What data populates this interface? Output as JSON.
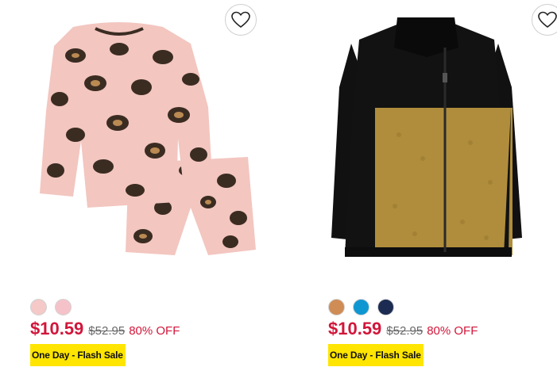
{
  "products": [
    {
      "image_alt": "leopard print pajama set",
      "wishlist_icon": "heart-outline-icon",
      "swatches": [
        "#f4c9c8",
        "#f6c2c9"
      ],
      "price": "$10.59",
      "original_price": "$52.95",
      "discount": "80% OFF",
      "badge": "One Day - Flash Sale"
    },
    {
      "image_alt": "black and tan sherpa jacket",
      "wishlist_icon": "heart-outline-icon",
      "swatches": [
        "#cf8c55",
        "#0f97d2",
        "#1c2b52"
      ],
      "price": "$10.59",
      "original_price": "$52.95",
      "discount": "80% OFF",
      "badge": "One Day - Flash Sale"
    }
  ],
  "colors": {
    "sale_red": "#d1163a",
    "badge_yellow": "#ffe500"
  }
}
